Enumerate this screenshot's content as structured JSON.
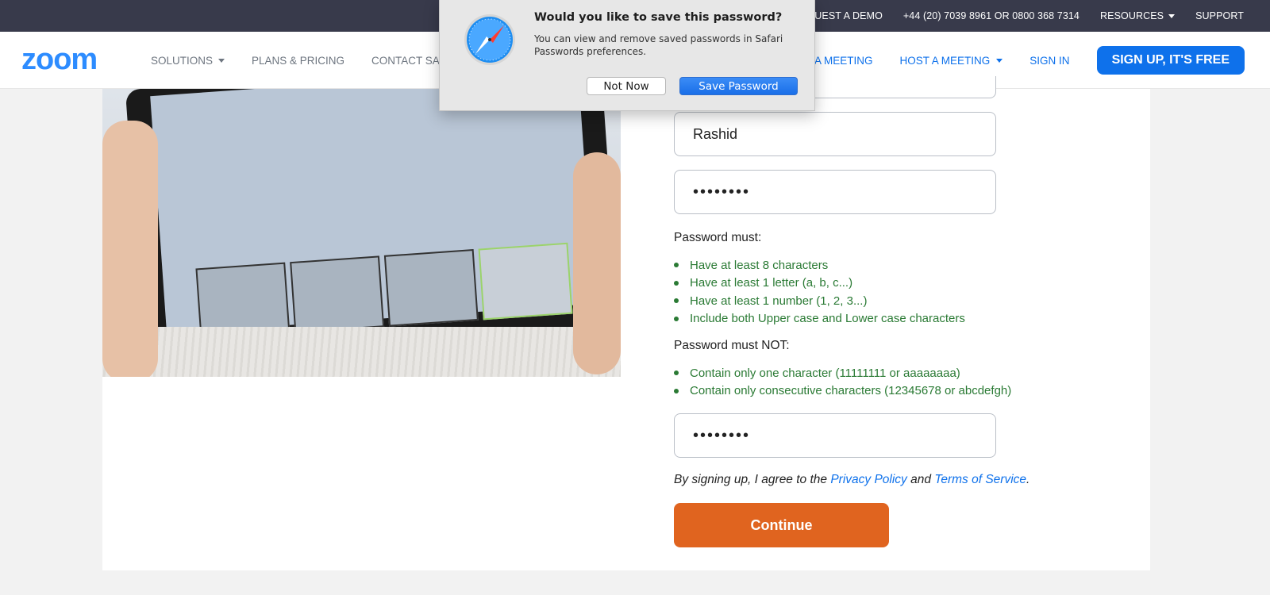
{
  "topbar": {
    "request_demo": "REQUEST A DEMO",
    "phone": "+44 (20) 7039 8961 OR 0800 368 7314",
    "resources": "RESOURCES",
    "support": "SUPPORT"
  },
  "nav": {
    "logo": "zoom",
    "solutions": "SOLUTIONS",
    "plans": "PLANS & PRICING",
    "contact": "CONTACT SALES",
    "join": "JOIN A MEETING",
    "host": "HOST A MEETING",
    "signin": "SIGN IN",
    "signup": "SIGN UP, IT'S FREE"
  },
  "dialog": {
    "title": "Would you like to save this password?",
    "message": "You can view and remove saved passwords in Safari Passwords preferences.",
    "not_now": "Not Now",
    "save": "Save Password"
  },
  "form": {
    "last_name": "Rashid",
    "password_mask": "••••••••",
    "confirm_mask": "••••••••",
    "must_label": "Password must:",
    "must_rules": [
      "Have at least 8 characters",
      "Have at least 1 letter (a, b, c...)",
      "Have at least 1 number (1, 2, 3...)",
      "Include both Upper case and Lower case characters"
    ],
    "must_not_label": "Password must NOT:",
    "must_not_rules": [
      "Contain only one character (11111111 or aaaaaaaa)",
      "Contain only consecutive characters (12345678 or abcdefgh)"
    ],
    "agree_prefix": "By signing up, I agree to the",
    "privacy": "Privacy Policy",
    "and": "and",
    "terms": "Terms of Service",
    "period": ".",
    "continue": "Continue"
  },
  "colors": {
    "brand_blue": "#0e71eb",
    "continue_orange": "#e0641f",
    "rule_green": "#2a7a34",
    "topbar": "#383a4b"
  }
}
